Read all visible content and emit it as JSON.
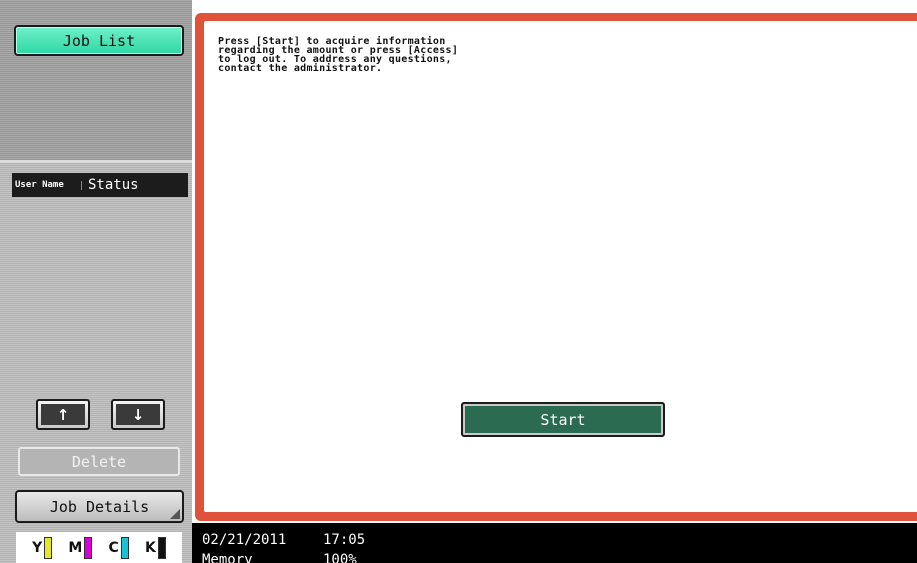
{
  "sidebar": {
    "job_list_label": "Job List",
    "columns": {
      "user_name": "User Name",
      "status": "Status"
    },
    "up_arrow": "↑",
    "down_arrow": "↓",
    "delete_label": "Delete",
    "job_details_label": "Job Details",
    "toner": [
      {
        "letter": "Y",
        "color": "#e7e62a"
      },
      {
        "letter": "M",
        "color": "#d800d8"
      },
      {
        "letter": "C",
        "color": "#18c3d8"
      },
      {
        "letter": "K",
        "color": "#111111"
      }
    ]
  },
  "main": {
    "message": "Press [Start] to acquire information\nregarding the amount or press [Access]\nto log out. To address any questions,\ncontact the administrator.",
    "start_label": "Start",
    "frame_color": "#e0533b"
  },
  "status_bar": {
    "date": "02/21/2011",
    "time": "17:05",
    "memory_label": "Memory",
    "memory_value": "100%"
  }
}
